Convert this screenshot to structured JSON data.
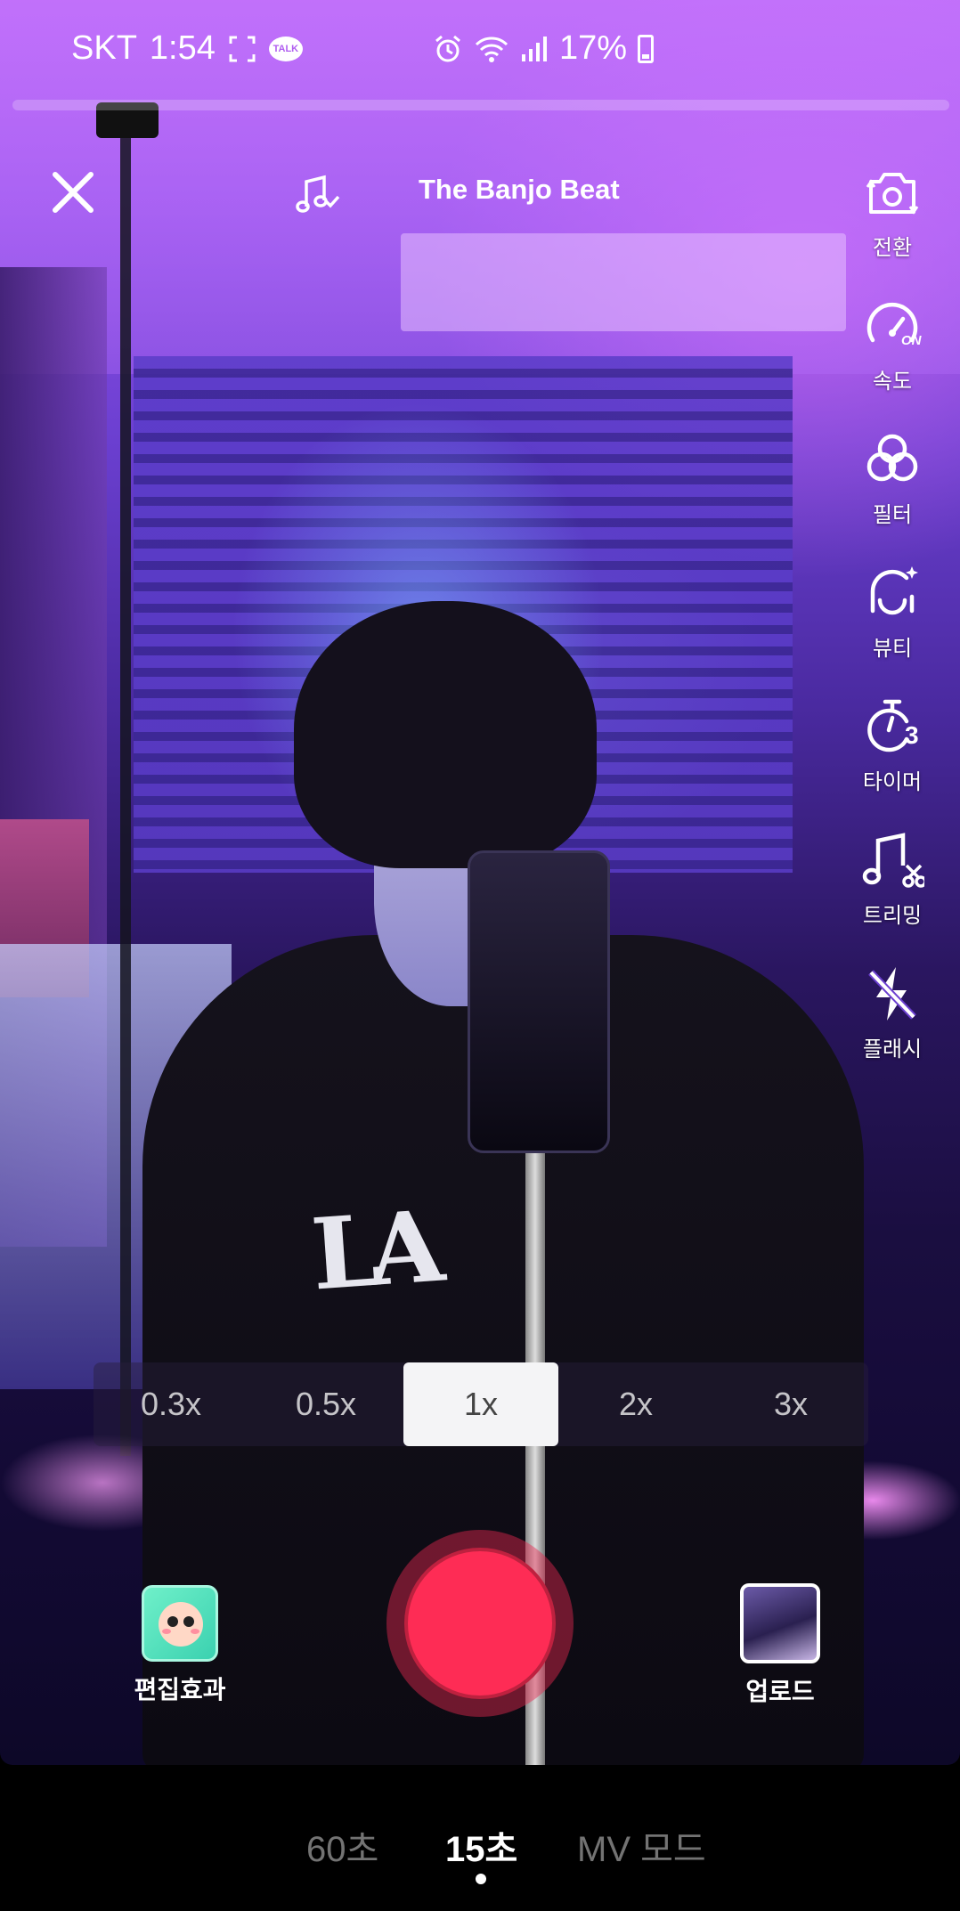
{
  "status_bar": {
    "carrier": "SKT",
    "time": "1:54",
    "talk_badge": "TALK",
    "battery": "17%"
  },
  "top_bar": {
    "song_title": "The Banjo Beat"
  },
  "tools": [
    {
      "label": "전환",
      "icon": "flip-camera-icon"
    },
    {
      "label": "속도",
      "icon": "speed-icon",
      "badge": "ON"
    },
    {
      "label": "필터",
      "icon": "filter-icon"
    },
    {
      "label": "뷰티",
      "icon": "beauty-icon"
    },
    {
      "label": "타이머",
      "icon": "timer-icon",
      "badge": "3"
    },
    {
      "label": "트리밍",
      "icon": "trim-sound-icon"
    },
    {
      "label": "플래시",
      "icon": "flash-off-icon"
    }
  ],
  "zoom": {
    "options": [
      "0.3x",
      "0.5x",
      "1x",
      "2x",
      "3x"
    ],
    "selected": "1x"
  },
  "bottom_controls": {
    "effects_label": "편집효과",
    "upload_label": "업로드"
  },
  "modes": {
    "options": [
      "60초",
      "15초",
      "MV 모드"
    ],
    "selected": "15초"
  },
  "colors": {
    "record": "#fe2c55",
    "accent": "#b05ef0"
  }
}
